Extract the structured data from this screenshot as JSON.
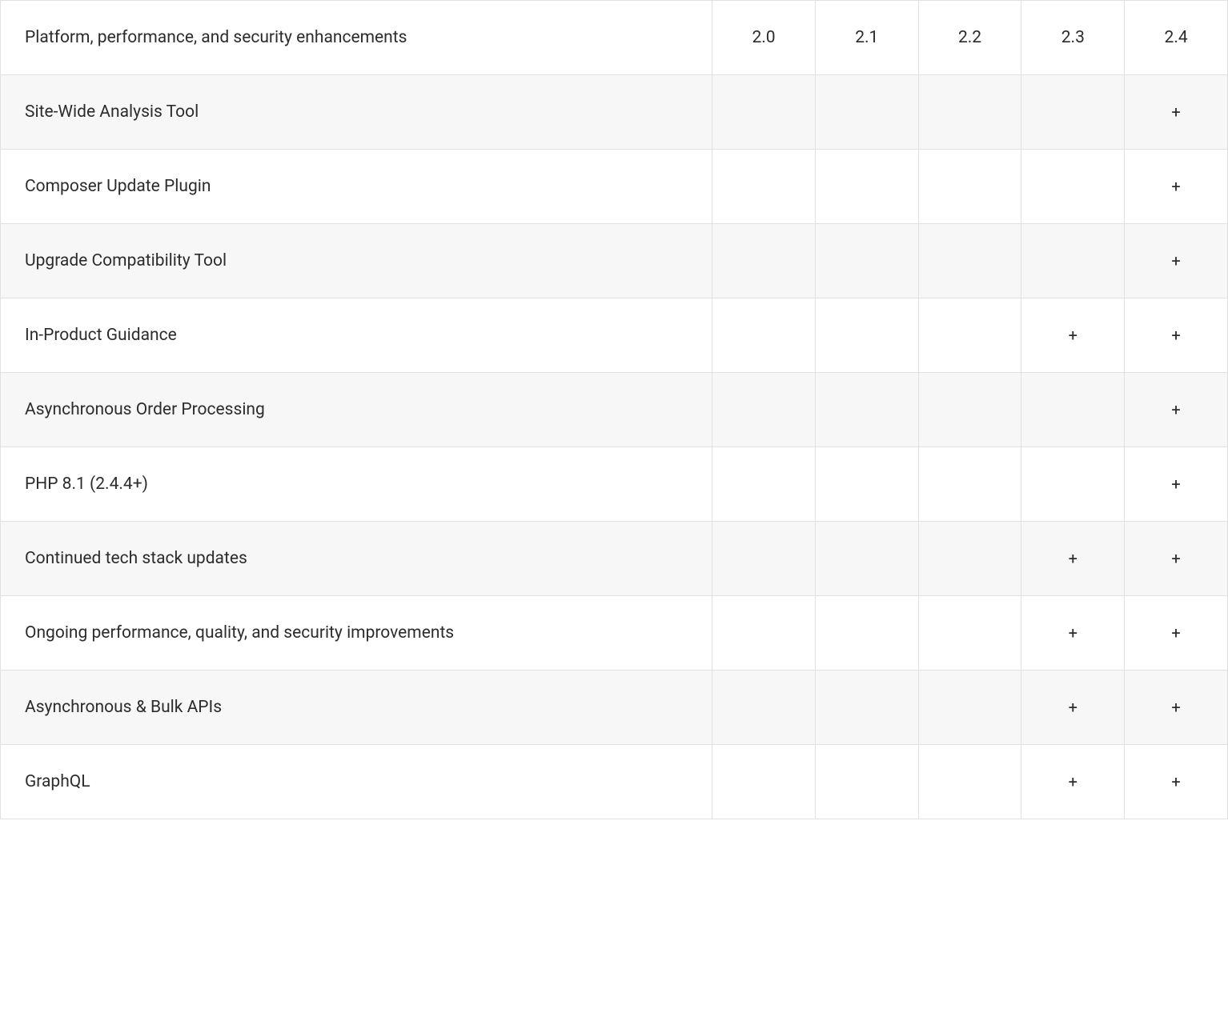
{
  "header": {
    "title": "Platform, performance, and security enhancements",
    "versions": [
      "2.0",
      "2.1",
      "2.2",
      "2.3",
      "2.4"
    ]
  },
  "mark": "+",
  "rows": [
    {
      "label": "Site-Wide Analysis Tool",
      "cells": [
        "",
        "",
        "",
        "",
        "+"
      ]
    },
    {
      "label": "Composer Update Plugin",
      "cells": [
        "",
        "",
        "",
        "",
        "+"
      ]
    },
    {
      "label": "Upgrade Compatibility Tool",
      "cells": [
        "",
        "",
        "",
        "",
        "+"
      ]
    },
    {
      "label": "In-Product Guidance",
      "cells": [
        "",
        "",
        "",
        "+",
        "+"
      ]
    },
    {
      "label": "Asynchronous Order Processing",
      "cells": [
        "",
        "",
        "",
        "",
        "+"
      ]
    },
    {
      "label": "PHP 8.1 (2.4.4+)",
      "cells": [
        "",
        "",
        "",
        "",
        "+"
      ]
    },
    {
      "label": "Continued tech stack updates",
      "cells": [
        "",
        "",
        "",
        "+",
        "+"
      ]
    },
    {
      "label": "Ongoing performance, quality, and security improvements",
      "cells": [
        "",
        "",
        "",
        "+",
        "+"
      ]
    },
    {
      "label": "Asynchronous & Bulk APIs",
      "cells": [
        "",
        "",
        "",
        "+",
        "+"
      ]
    },
    {
      "label": "GraphQL",
      "cells": [
        "",
        "",
        "",
        "+",
        "+"
      ]
    }
  ]
}
